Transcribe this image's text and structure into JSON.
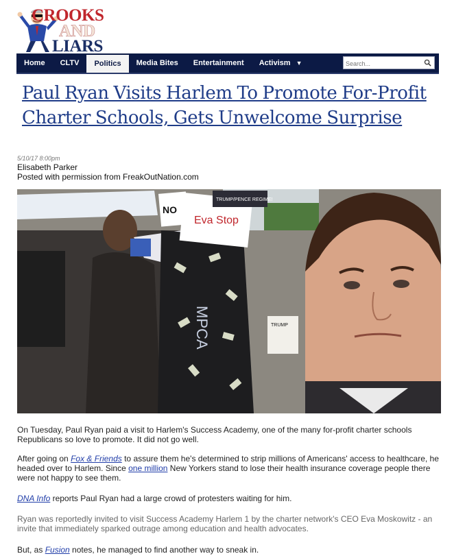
{
  "logo": {
    "line1": "CROOKS",
    "line2": "AND",
    "line3": "LIARS"
  },
  "nav": {
    "items": [
      "Home",
      "CLTV",
      "Politics",
      "Media Bites",
      "Entertainment",
      "Activism"
    ],
    "active": "Politics",
    "activism_caret": "▼",
    "search_placeholder": "Search..."
  },
  "article": {
    "headline": "Paul Ryan Visits Harlem To Promote For-Profit Charter Schools, Gets Unwelcome Surprise",
    "date": "5/10/17 8:00pm",
    "author": "Elisabeth Parker",
    "permission": "Posted with permission from FreakOutNation.com",
    "image_signs": [
      "NO",
      "Eva Stop",
      "TRUMP/PENCE REGIME!",
      "MPCA",
      "TRUMP"
    ],
    "p1": "On Tuesday, Paul Ryan paid a visit to Harlem's Success Academy, one of the many for-profit charter schools Republicans so love to promote. It did not go well.",
    "p2_a": "After going on ",
    "p2_link1": "Fox & Friends",
    "p2_b": " to assure them he's determined to strip millions of Americans' access to healthcare, he headed over to Harlem. Since ",
    "p2_link2": "one million",
    "p2_c": " New Yorkers stand to lose their health insurance coverage people there were not happy to see them.",
    "p3_link": "DNA Info",
    "p3_rest": " reports Paul Ryan had a large crowd of protesters waiting for him.",
    "p4": "Ryan was reportedly invited to visit Success Academy Harlem 1 by the charter network's CEO Eva Moskowitz - an invite that immediately sparked outrage among education and health advocates.",
    "p5_a": "But, as ",
    "p5_link": "Fusion",
    "p5_b": " notes, he managed to find another way to sneak in."
  }
}
